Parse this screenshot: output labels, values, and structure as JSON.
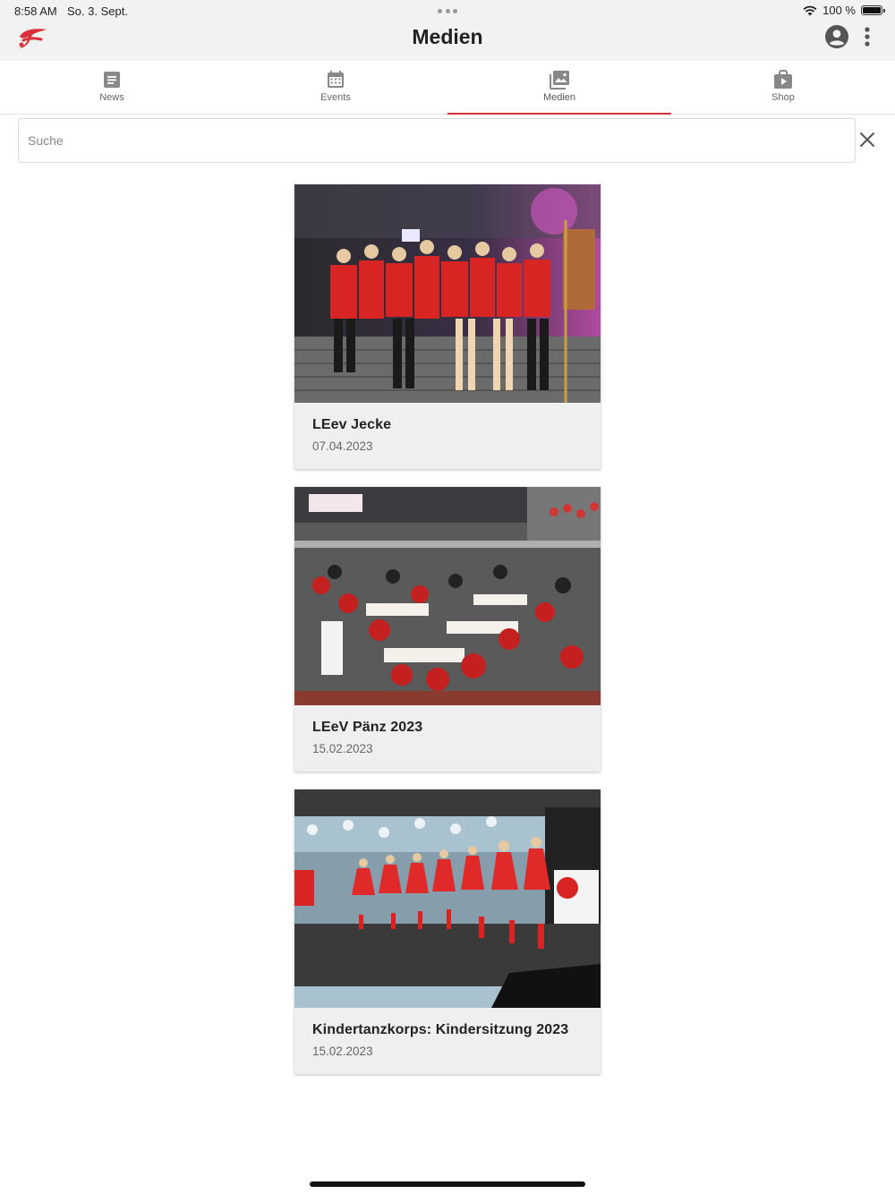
{
  "status_bar": {
    "time": "8:58 AM",
    "date": "So. 3. Sept.",
    "battery": "100 %"
  },
  "header": {
    "title": "Medien",
    "logo_icon": "fastelovend-logo-icon",
    "account_icon": "account-circle-icon",
    "menu_icon": "more-vert-icon"
  },
  "tabs": [
    {
      "label": "News",
      "icon": "article-icon",
      "active": false
    },
    {
      "label": "Events",
      "icon": "calendar-icon",
      "active": false
    },
    {
      "label": "Medien",
      "icon": "photo-library-icon",
      "active": true
    },
    {
      "label": "Shop",
      "icon": "shop-bag-icon",
      "active": false
    }
  ],
  "search": {
    "placeholder": "Suche",
    "value": ""
  },
  "media": [
    {
      "title": "LEev Jecke",
      "date": "07.04.2023"
    },
    {
      "title": "LEeV Pänz 2023",
      "date": "15.02.2023"
    },
    {
      "title": "Kindertanzkorps: Kindersitzung 2023",
      "date": "15.02.2023"
    }
  ],
  "colors": {
    "accent": "#d9323a",
    "header_bg": "#f2f2f2",
    "card_bg": "#efefef"
  }
}
